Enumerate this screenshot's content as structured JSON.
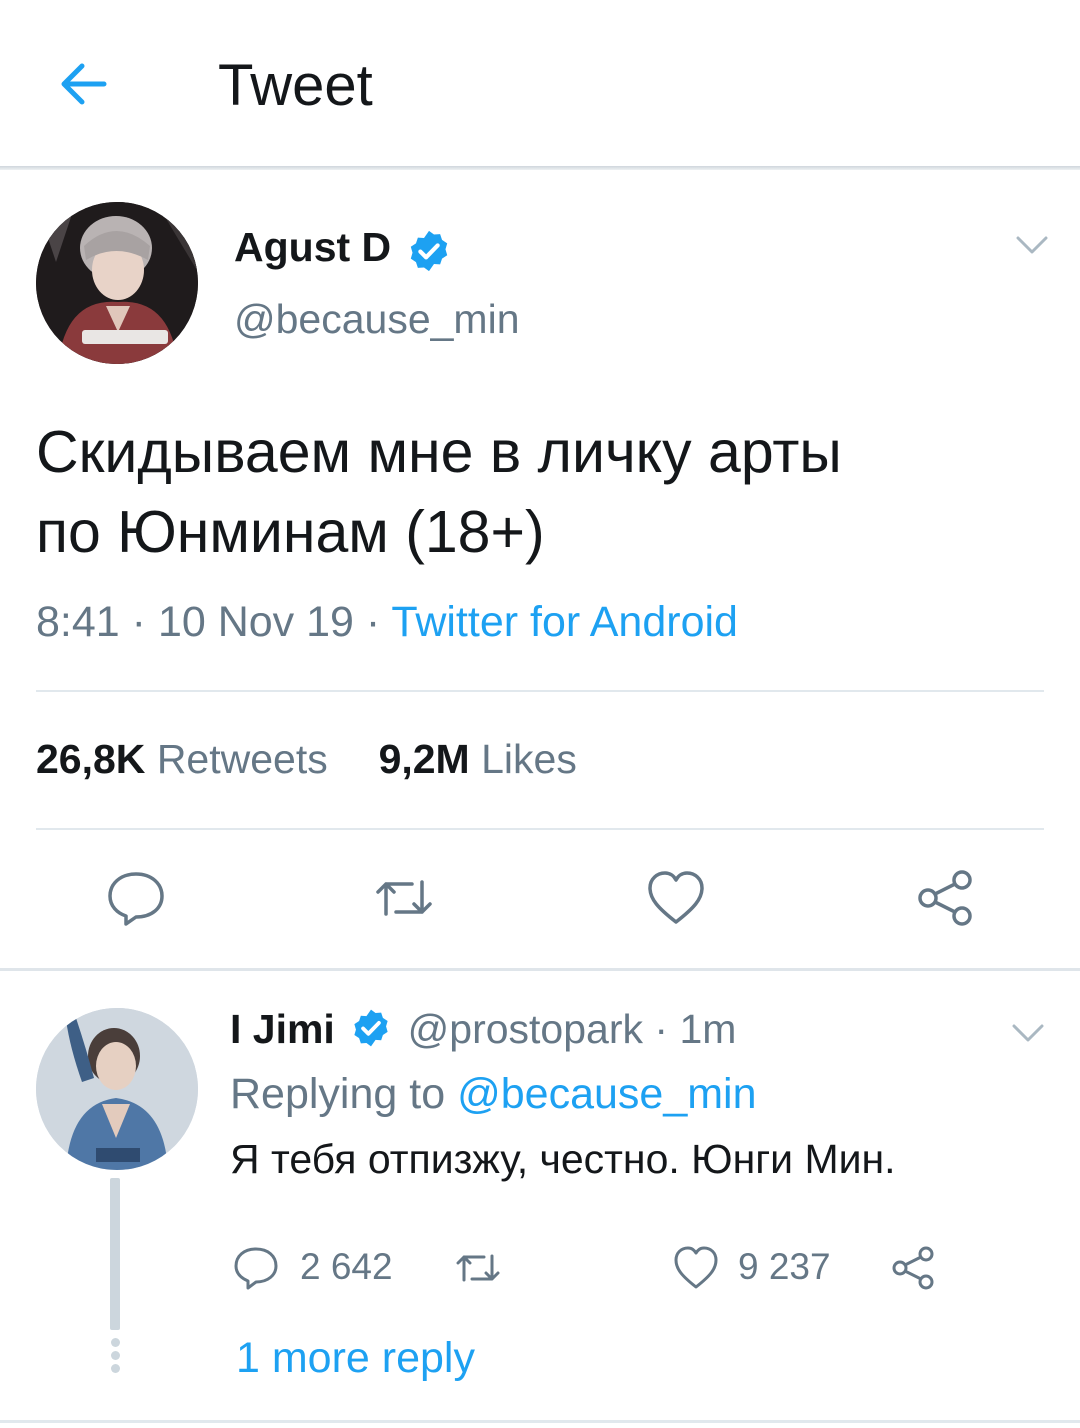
{
  "header": {
    "title": "Tweet",
    "back_icon": "arrow-left-icon"
  },
  "colors": {
    "accent": "#1da1f2",
    "text": "#14171a",
    "secondary": "#657786",
    "divider": "#e1e8ed"
  },
  "tweet": {
    "author_name": "Agust D",
    "author_handle": "@because_min",
    "verified_icon": "verified-badge-icon",
    "text_line1": "Скидываем мне в личку арты",
    "text_line2": "по Юнминам (18+)",
    "time": "8:41",
    "date": "10 Nov 19",
    "source": "Twitter for Android",
    "retweets_count": "26,8K",
    "retweets_label": "Retweets",
    "likes_count": "9,2M",
    "likes_label": "Likes",
    "actions": [
      "reply-icon",
      "retweet-icon",
      "like-icon",
      "share-icon"
    ]
  },
  "reply": {
    "author_name": "I Jimi",
    "author_handle": "@prostopark",
    "age": "1m",
    "replying_prefix": "Replying to",
    "replying_to": "@because_min",
    "text": "Я тебя отпизжу, честно. Юнги Мин.",
    "reply_count": "2 642",
    "like_count": "9 237",
    "more_replies": "1 more reply"
  }
}
